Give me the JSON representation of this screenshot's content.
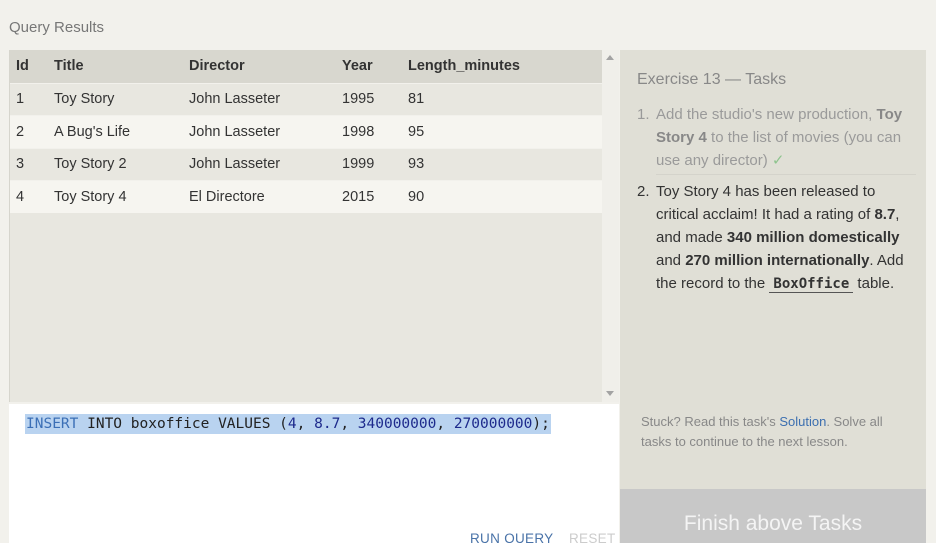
{
  "header": {
    "title": "Query Results"
  },
  "results": {
    "columns": [
      "Id",
      "Title",
      "Director",
      "Year",
      "Length_minutes"
    ],
    "rows": [
      [
        "1",
        "Toy Story",
        "John Lasseter",
        "1995",
        "81"
      ],
      [
        "2",
        "A Bug's Life",
        "John Lasseter",
        "1998",
        "95"
      ],
      [
        "3",
        "Toy Story 2",
        "John Lasseter",
        "1999",
        "93"
      ],
      [
        "4",
        "Toy Story 4",
        "El Directore",
        "2015",
        "90"
      ]
    ]
  },
  "editor": {
    "kw1": "INSERT",
    "mid": " INTO boxoffice VALUES (",
    "v1": "4",
    "v2": "8.7",
    "v3": "340000000",
    "v4": "270000000",
    "sep": ", ",
    "end": ");",
    "run_label": "RUN QUERY",
    "reset_label": "RESET"
  },
  "sidebar": {
    "title": "Exercise 13 — Tasks",
    "task1": {
      "num": "1.",
      "pre": "Add the studio's new production, ",
      "bold": "Toy Story 4",
      "post": " to the list of movies (you can use any director)",
      "check": "✓"
    },
    "task2": {
      "num": "2.",
      "t1": "Toy Story 4 has been released to critical acclaim! It had a rating of ",
      "b1": "8.7",
      "t2": ", and made ",
      "b2": "340 million domestically",
      "t3": " and ",
      "b3": "270 million internationally",
      "t4": ". Add the record to the ",
      "code": "BoxOffice",
      "t5": " table."
    },
    "stuck_pre": "Stuck? Read this task's ",
    "stuck_link": "Solution",
    "stuck_post": ". Solve all tasks to continue to the next lesson.",
    "finish_label": "Finish above Tasks"
  }
}
